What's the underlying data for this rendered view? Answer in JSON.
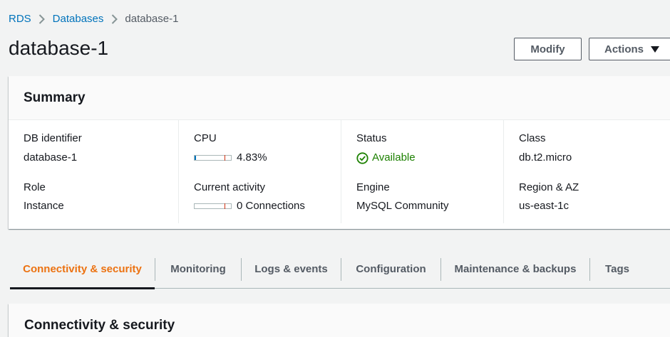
{
  "breadcrumb": {
    "items": [
      "RDS",
      "Databases"
    ],
    "current": "database-1"
  },
  "page": {
    "title": "database-1"
  },
  "actions": {
    "modify_label": "Modify",
    "actions_label": "Actions"
  },
  "summary": {
    "title": "Summary",
    "db_identifier": {
      "label": "DB identifier",
      "value": "database-1"
    },
    "cpu": {
      "label": "CPU",
      "value": "4.83%",
      "fraction": 0.0483
    },
    "status": {
      "label": "Status",
      "value": "Available",
      "color": "#1d8102"
    },
    "class": {
      "label": "Class",
      "value": "db.t2.micro"
    },
    "role": {
      "label": "Role",
      "value": "Instance"
    },
    "current_activity": {
      "label": "Current activity",
      "value": "0 Connections",
      "fraction": 0
    },
    "engine": {
      "label": "Engine",
      "value": "MySQL Community"
    },
    "region": {
      "label": "Region & AZ",
      "value": "us-east-1c"
    }
  },
  "tabs": [
    {
      "label": "Connectivity & security",
      "active": true
    },
    {
      "label": "Monitoring",
      "active": false
    },
    {
      "label": "Logs & events",
      "active": false
    },
    {
      "label": "Configuration",
      "active": false
    },
    {
      "label": "Maintenance & backups",
      "active": false
    },
    {
      "label": "Tags",
      "active": false
    }
  ],
  "section": {
    "title": "Connectivity & security"
  },
  "colors": {
    "link": "#0073bb",
    "active_tab": "#ec7211",
    "success": "#1d8102",
    "threshold": "#d13212"
  },
  "icons": {
    "breadcrumb_separator": "chevron-right-icon",
    "actions_dropdown": "caret-down-icon",
    "status": "check-circle-icon"
  }
}
